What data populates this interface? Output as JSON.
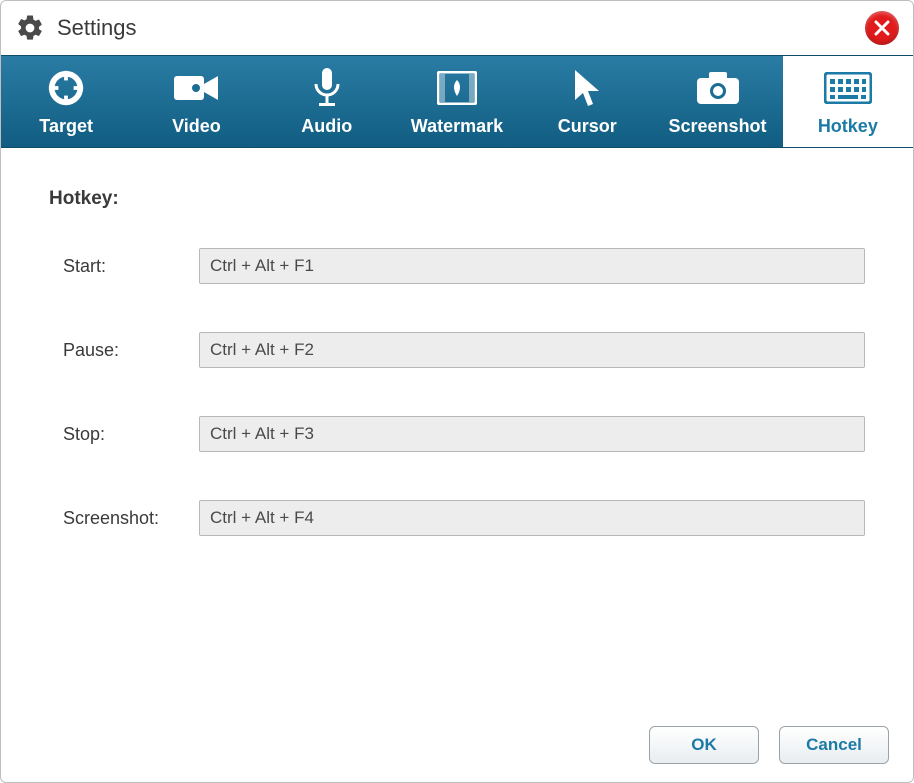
{
  "window": {
    "title": "Settings"
  },
  "tabs": [
    {
      "label": "Target"
    },
    {
      "label": "Video"
    },
    {
      "label": "Audio"
    },
    {
      "label": "Watermark"
    },
    {
      "label": "Cursor"
    },
    {
      "label": "Screenshot"
    },
    {
      "label": "Hotkey"
    }
  ],
  "hotkey": {
    "section_title": "Hotkey:",
    "rows": {
      "start": {
        "label": "Start:",
        "value": "Ctrl + Alt + F1"
      },
      "pause": {
        "label": "Pause:",
        "value": "Ctrl + Alt + F2"
      },
      "stop": {
        "label": "Stop:",
        "value": "Ctrl + Alt + F3"
      },
      "screenshot": {
        "label": "Screenshot:",
        "value": "Ctrl + Alt + F4"
      }
    }
  },
  "footer": {
    "ok_label": "OK",
    "cancel_label": "Cancel"
  }
}
